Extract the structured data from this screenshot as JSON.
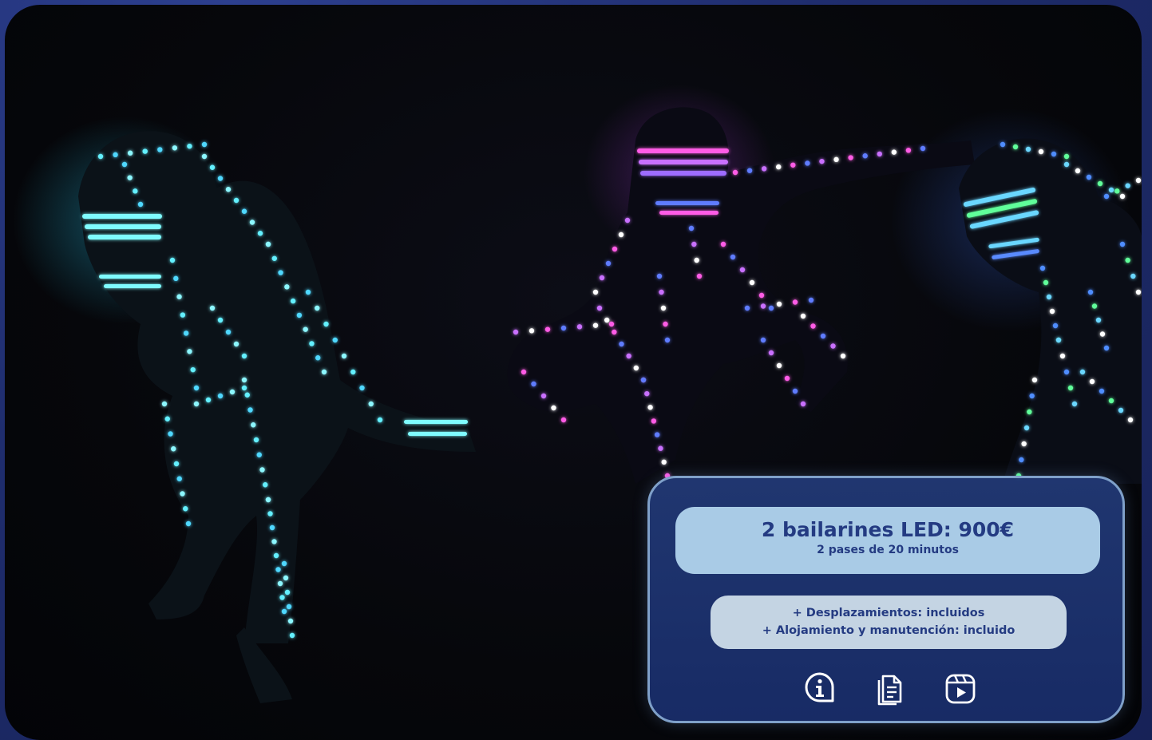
{
  "offer": {
    "title": "2 bailarines LED: 900€",
    "subtitle": "2 pases de 20 minutos",
    "extras": [
      "+ Desplazamientos: incluidos",
      "+ Alojamiento y manutención: incluido"
    ]
  },
  "actions": [
    {
      "name": "info-icon",
      "icon": "info-icon"
    },
    {
      "name": "document-icon",
      "icon": "document-icon"
    },
    {
      "name": "video-icon",
      "icon": "video-icon"
    }
  ],
  "colors": {
    "page_background": "#1f2d6e",
    "card_background": "#1e3570",
    "card_border": "#7fa0c9",
    "price_box": "#a9cbe6",
    "extras_box": "#c4d4e3",
    "text_dark_blue": "#243b82",
    "led_cyan": "#39e0ff",
    "led_magenta": "#ff3fd6",
    "led_blue": "#4a6bff"
  }
}
